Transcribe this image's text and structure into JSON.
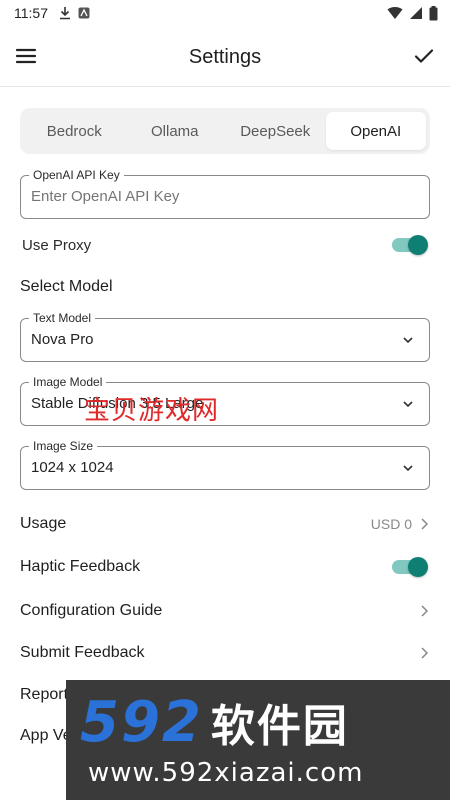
{
  "status": {
    "time": "11:57"
  },
  "appbar": {
    "title": "Settings"
  },
  "tabs": [
    {
      "label": "Bedrock",
      "active": false
    },
    {
      "label": "Ollama",
      "active": false
    },
    {
      "label": "DeepSeek",
      "active": false
    },
    {
      "label": "OpenAI",
      "active": true
    }
  ],
  "apikey": {
    "legend": "OpenAI API Key",
    "placeholder": "Enter OpenAI API Key",
    "value": ""
  },
  "proxy": {
    "label": "Use Proxy",
    "enabled": true
  },
  "select_model": {
    "title": "Select Model"
  },
  "text_model": {
    "legend": "Text Model",
    "value": "Nova Pro"
  },
  "image_model": {
    "legend": "Image Model",
    "value": "Stable Diffusion 3.5 Large"
  },
  "image_size": {
    "legend": "Image Size",
    "value": "1024 x 1024"
  },
  "usage": {
    "label": "Usage",
    "value": "USD 0"
  },
  "haptic": {
    "label": "Haptic Feedback",
    "enabled": true
  },
  "config_guide": {
    "label": "Configuration Guide"
  },
  "submit_feedback": {
    "label": "Submit Feedback"
  },
  "report": {
    "label": "Report"
  },
  "app_version": {
    "label": "App Ve"
  },
  "watermark": {
    "overlay_text": "宝贝游戏网",
    "banner_number": "592",
    "banner_name": "软件园",
    "banner_url": "www.592xiazai.com"
  },
  "colors": {
    "accent": "#0f7f73",
    "accent_track": "#80c8c0"
  }
}
